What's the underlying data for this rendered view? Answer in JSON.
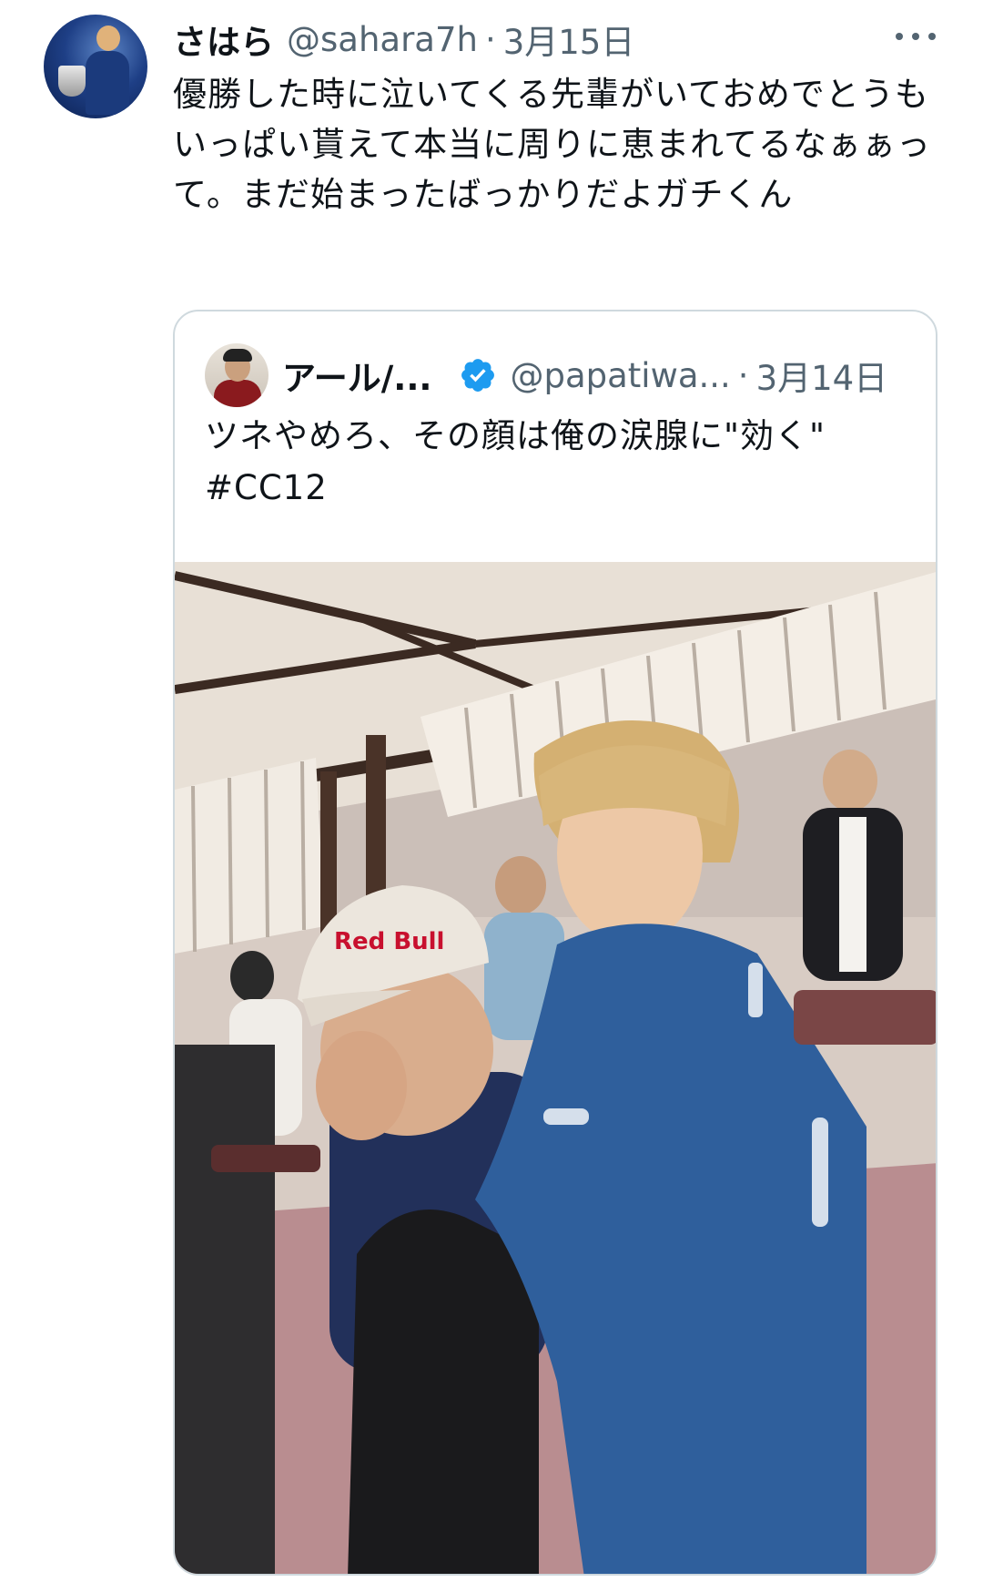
{
  "tweet": {
    "author_name": "さはら",
    "author_handle": "@sahara7h",
    "separator": "·",
    "date": "3月15日",
    "more_icon": "more-horizontal-icon",
    "text": "優勝した時に泣いてくる先輩がいておめでとうもいっぱい貰えて本当に周りに恵まれてるなぁぁって。まだ始まったばっかりだよガチくん"
  },
  "quote": {
    "author_name": "アール/...",
    "verified_icon": "verified-badge-icon",
    "author_handle": "@papatiwa...",
    "separator": "·",
    "date": "3月14日",
    "text_line1": "ツネやめろ、その顔は俺の涙腺に\"効く\"",
    "text_line2": "#CC12",
    "photo_cap_text": "Red Bull"
  },
  "colors": {
    "text": "#0f1419",
    "secondary": "#536471",
    "border": "#cfd9de",
    "verified": "#1d9bf0",
    "jacket": "#2f5f9c"
  }
}
